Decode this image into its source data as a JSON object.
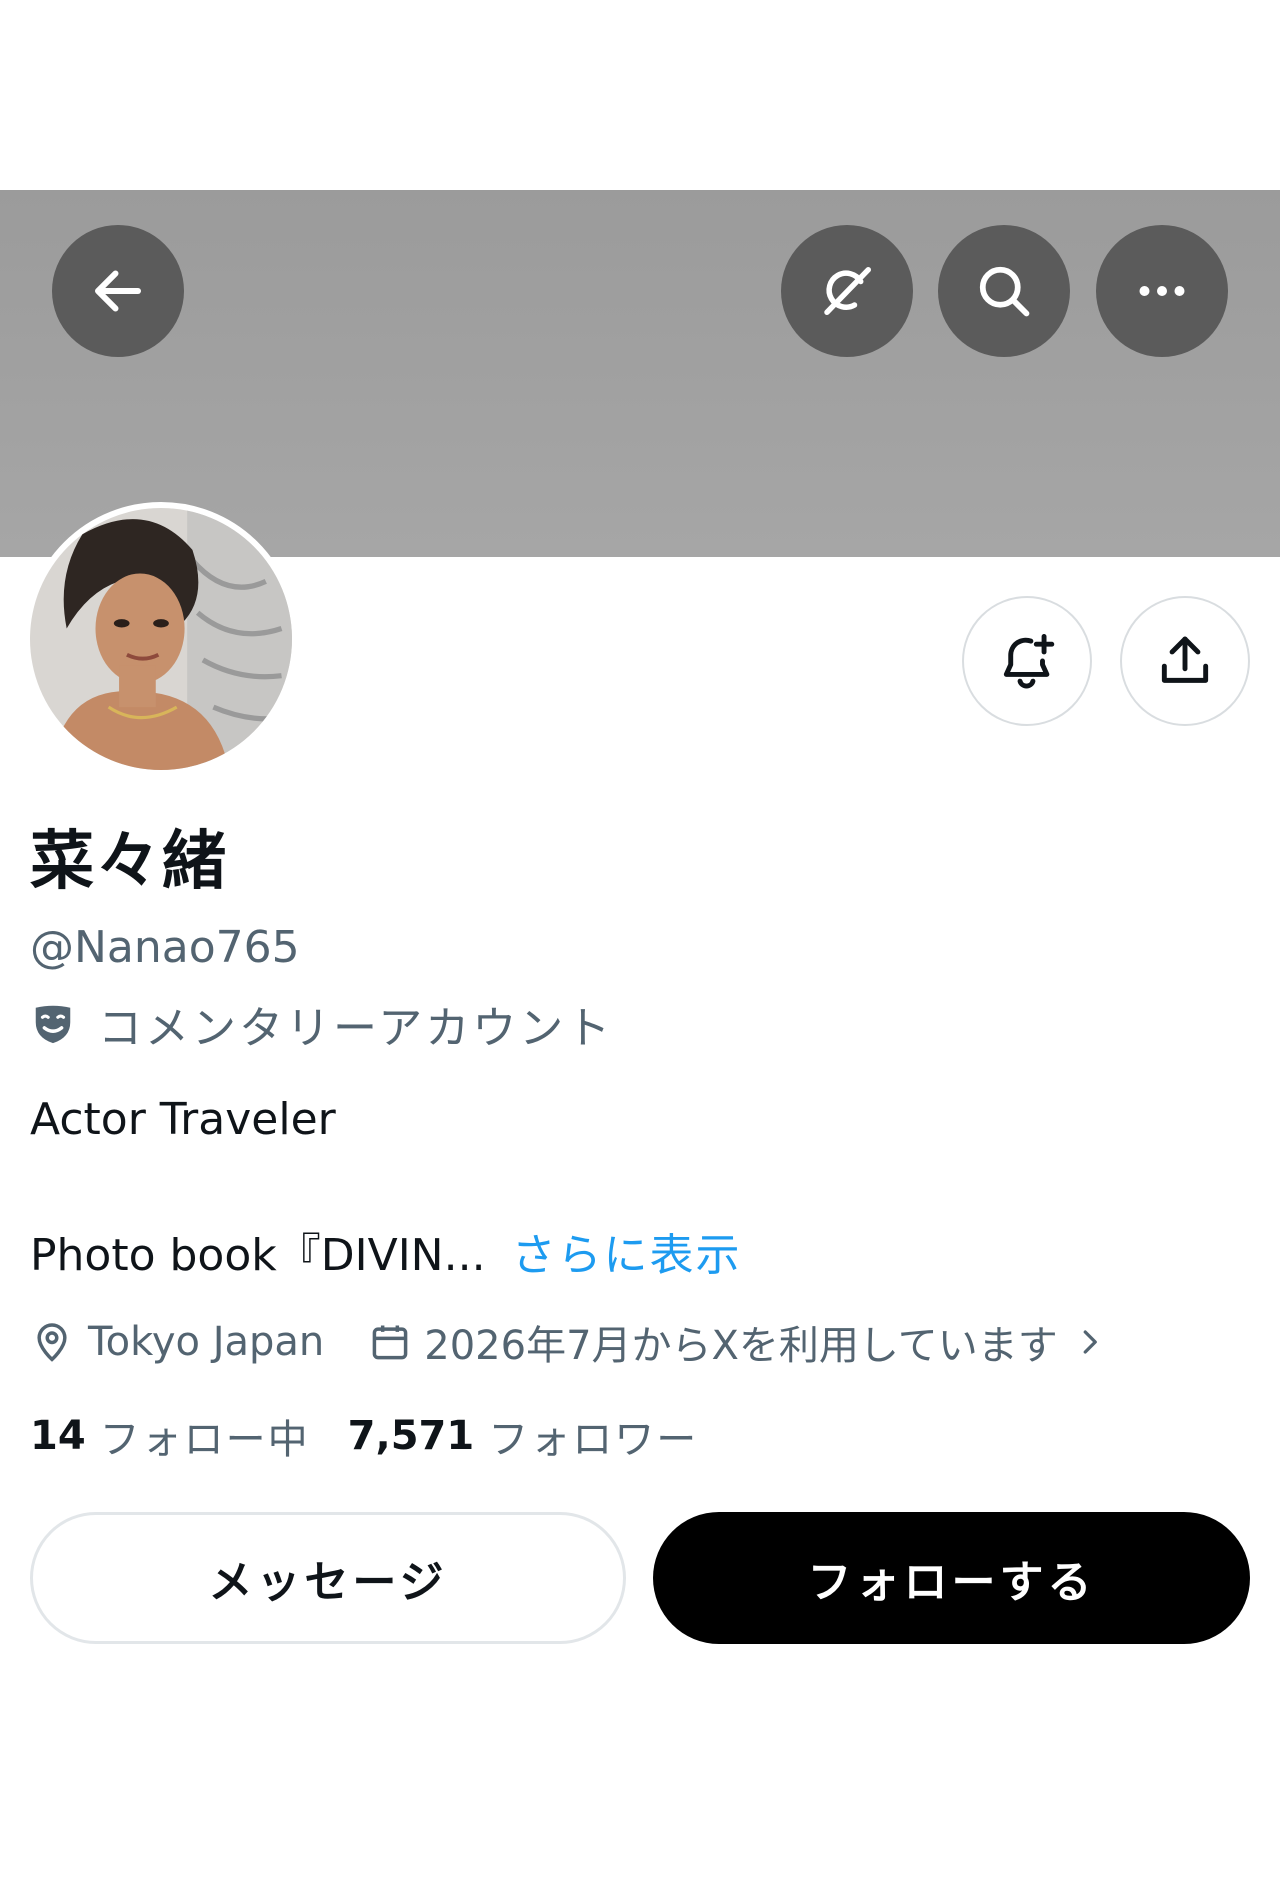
{
  "header": {
    "back_icon": "arrow-left-icon",
    "grok_icon": "grok-icon",
    "search_icon": "search-icon",
    "more_icon": "more-horizontal-icon",
    "banner_color": "#a0a0a0",
    "button_color": "#5b5b5b"
  },
  "profile": {
    "display_name": "菜々緒",
    "handle": "@Nanao765",
    "label": "コメンタリーアカウント",
    "label_icon": "theater-mask-icon",
    "bio_line1": "Actor Traveler",
    "bio_line2": "Photo book『DIVIN...",
    "show_more": "さらに表示",
    "location": "Tokyo Japan",
    "location_icon": "location-pin-icon",
    "joined": "2026年7月からXを利用しています",
    "joined_icon": "calendar-icon",
    "following_count": "14",
    "following_label": "フォロー中",
    "followers_count": "7,571",
    "followers_label": "フォロワー"
  },
  "actions": {
    "notify_icon": "bell-plus-icon",
    "share_icon": "share-upload-icon",
    "message_label": "メッセージ",
    "follow_label": "フォローする"
  },
  "colors": {
    "link": "#1d9bf0",
    "secondary_text": "#536471",
    "primary_text": "#0f1419"
  }
}
